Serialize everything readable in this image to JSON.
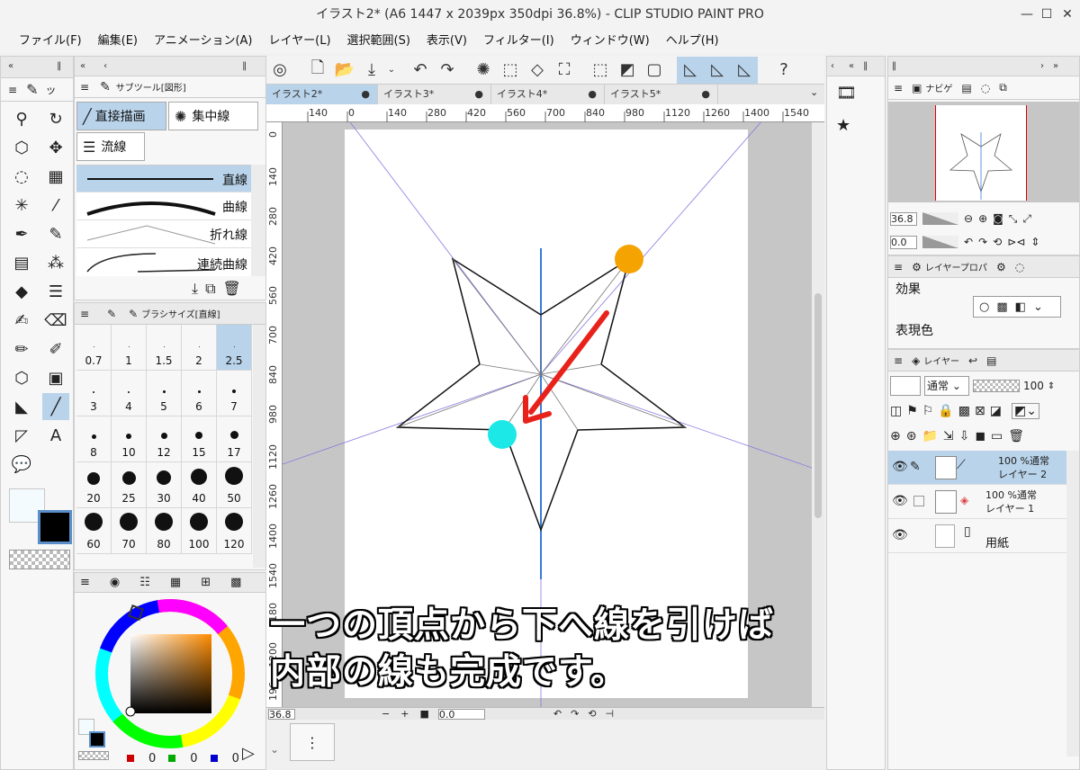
{
  "window": {
    "title": "イラスト2* (A6 1447 x 2039px 350dpi 36.8%)  - CLIP STUDIO PAINT PRO",
    "minimize": "—",
    "maximize": "☐",
    "close": "✕"
  },
  "menu": [
    "ファイル(F)",
    "編集(E)",
    "アニメーション(A)",
    "レイヤー(L)",
    "選択範囲(S)",
    "表示(V)",
    "フィルター(I)",
    "ウィンドウ(W)",
    "ヘルプ(H)"
  ],
  "subtool": {
    "header": "サブツール[図形]",
    "buttons": [
      "直接描画",
      "集中線",
      "流線"
    ],
    "lines": [
      "直線",
      "曲線",
      "折れ線",
      "連続曲線"
    ]
  },
  "brush_size": {
    "header": "ブラシサイズ[直線]",
    "sizes": [
      "0.7",
      "1",
      "1.5",
      "2",
      "2.5",
      "3",
      "4",
      "5",
      "6",
      "7",
      "8",
      "10",
      "12",
      "15",
      "17",
      "20",
      "25",
      "30",
      "40",
      "50",
      "60",
      "70",
      "80",
      "100",
      "120"
    ],
    "selected": "2.5"
  },
  "color": {
    "main": "#000000",
    "sub": "#f4fbff",
    "r": "0",
    "g": "0",
    "b": "0"
  },
  "tabs": [
    "イラスト2*",
    "イラスト3*",
    "イラスト4*",
    "イラスト5*"
  ],
  "ruler": {
    "top": [
      "140",
      "0",
      "140",
      "280",
      "420",
      "560",
      "700",
      "840",
      "980",
      "1120",
      "1260",
      "1400",
      "1540"
    ],
    "left": [
      "0",
      "140",
      "280",
      "420",
      "560",
      "700",
      "840",
      "980",
      "1120",
      "1260",
      "1400",
      "1540",
      "1180",
      "1200",
      "196"
    ]
  },
  "statusbar": {
    "zoom": "36.8",
    "angle": "0.0"
  },
  "caption": [
    "一つの頂点から下へ線を引けば",
    "内部の線も完成です。"
  ],
  "navigator": {
    "header": "ナビゲ",
    "zoom": "36.8",
    "angle": "0.0"
  },
  "layer_property": {
    "header": "レイヤープロパ",
    "effect_label": "効果",
    "expression_label": "表現色"
  },
  "layers": {
    "header": "レイヤー",
    "blend_mode": "通常",
    "opacity": "100",
    "items": [
      {
        "mode": "100 %通常",
        "name": "レイヤー 2"
      },
      {
        "mode": "100 %通常",
        "name": "レイヤー 1"
      },
      {
        "mode": "",
        "name": "用紙"
      }
    ]
  }
}
